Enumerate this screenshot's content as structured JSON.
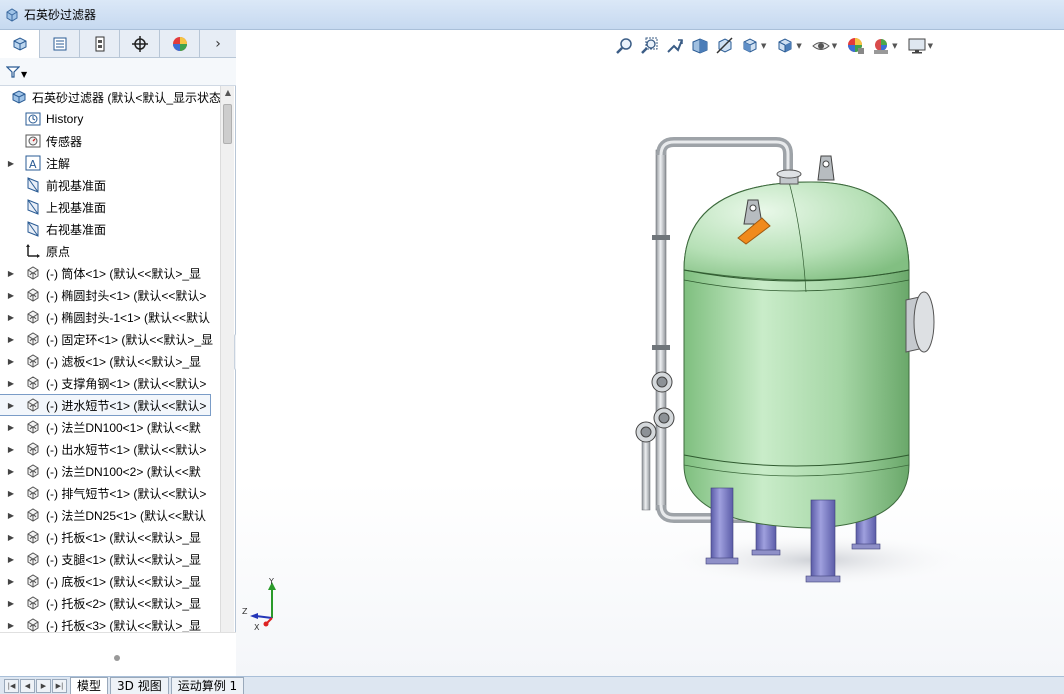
{
  "window": {
    "title": "石英砂过滤器"
  },
  "panel_tabs": [
    {
      "name": "featuremanager-tab",
      "icon": "part-tree-icon"
    },
    {
      "name": "propertymanager-tab",
      "icon": "property-list-icon"
    },
    {
      "name": "configurationmanager-tab",
      "icon": "configuration-icon"
    },
    {
      "name": "dimxpert-tab",
      "icon": "crosshair-icon"
    },
    {
      "name": "displaymanager-tab",
      "icon": "color-wheel-icon"
    }
  ],
  "tree": {
    "root": "石英砂过滤器 (默认<默认_显示状态",
    "items": [
      {
        "label": "History",
        "icon": "history-icon",
        "expandable": false
      },
      {
        "label": "传感器",
        "icon": "sensor-icon",
        "expandable": false
      },
      {
        "label": "注解",
        "icon": "annotation-icon",
        "expandable": true
      },
      {
        "label": "前视基准面",
        "icon": "plane-icon",
        "expandable": false
      },
      {
        "label": "上视基准面",
        "icon": "plane-icon",
        "expandable": false
      },
      {
        "label": "右视基准面",
        "icon": "plane-icon",
        "expandable": false
      },
      {
        "label": "原点",
        "icon": "origin-icon",
        "expandable": false
      },
      {
        "label": "(-) 筒体<1> (默认<<默认>_显",
        "icon": "part-icon",
        "expandable": true
      },
      {
        "label": "(-) 椭圆封头<1> (默认<<默认>",
        "icon": "part-icon",
        "expandable": true
      },
      {
        "label": "(-) 椭圆封头-1<1> (默认<<默认",
        "icon": "part-icon",
        "expandable": true
      },
      {
        "label": "(-) 固定环<1> (默认<<默认>_显",
        "icon": "part-icon",
        "expandable": true
      },
      {
        "label": "(-) 滤板<1> (默认<<默认>_显",
        "icon": "part-icon",
        "expandable": true
      },
      {
        "label": "(-) 支撑角钢<1> (默认<<默认>",
        "icon": "part-icon",
        "expandable": true
      },
      {
        "label": "(-) 进水短节<1> (默认<<默认>",
        "icon": "part-icon",
        "expandable": true,
        "selected": true
      },
      {
        "label": "(-) 法兰DN100<1> (默认<<默",
        "icon": "part-icon",
        "expandable": true
      },
      {
        "label": "(-) 出水短节<1> (默认<<默认>",
        "icon": "part-icon",
        "expandable": true
      },
      {
        "label": "(-) 法兰DN100<2> (默认<<默",
        "icon": "part-icon",
        "expandable": true
      },
      {
        "label": "(-) 排气短节<1> (默认<<默认>",
        "icon": "part-icon",
        "expandable": true
      },
      {
        "label": "(-) 法兰DN25<1> (默认<<默认",
        "icon": "part-icon",
        "expandable": true
      },
      {
        "label": "(-) 托板<1> (默认<<默认>_显",
        "icon": "part-icon",
        "expandable": true
      },
      {
        "label": "(-) 支腿<1> (默认<<默认>_显",
        "icon": "part-icon",
        "expandable": true
      },
      {
        "label": "(-) 底板<1> (默认<<默认>_显",
        "icon": "part-icon",
        "expandable": true
      },
      {
        "label": "(-) 托板<2> (默认<<默认>_显",
        "icon": "part-icon",
        "expandable": true
      },
      {
        "label": "(-) 托板<3> (默认<<默认>_显",
        "icon": "part-icon",
        "expandable": true
      }
    ]
  },
  "view_toolbar": [
    "zoom-to-fit-icon",
    "zoom-to-area-icon",
    "previous-view-icon",
    "section-view-icon",
    "dynamic-annotation-icon",
    "view-orientation-icon",
    "display-style-icon",
    "hide-show-icon",
    "edit-appearance-icon",
    "apply-scene-icon",
    "view-settings-icon"
  ],
  "triad": {
    "y": "Y",
    "x": "X",
    "z": "Z"
  },
  "bottom_tabs": [
    {
      "label": "模型",
      "active": true
    },
    {
      "label": "3D 视图",
      "active": false
    },
    {
      "label": "运动算例 1",
      "active": false
    }
  ],
  "colors": {
    "tank_green": "#a8d8a8",
    "legs_blue": "#7e7fc6",
    "pipe_gray": "#c8ccd0",
    "lug_orange": "#f08a1c"
  }
}
